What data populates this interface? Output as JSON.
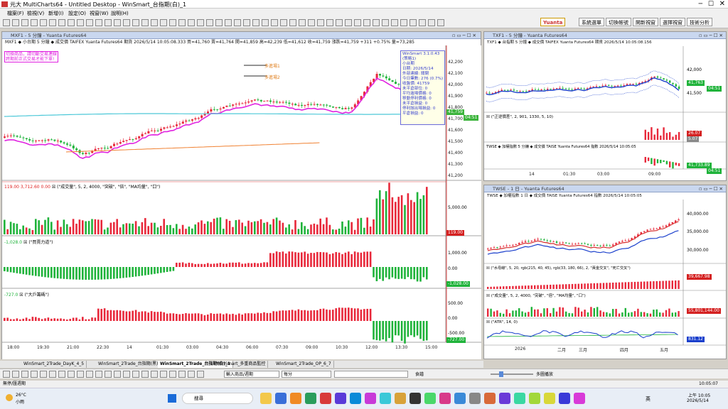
{
  "app": {
    "title": "元大 MultiCharts64 - Untitled Desktop - WinSmart_台指期(白)_1"
  },
  "menu": [
    "檔案(F)",
    "檢視(V)",
    "新增(I)",
    "設定(O)",
    "視窗(W)",
    "說明(H)"
  ],
  "toolbar_brand": {
    "logo": "Yuanta",
    "buttons": [
      "系統選單",
      "切換帳號",
      "開新視窗",
      "選擇視窗",
      "技術分析"
    ]
  },
  "left_window": {
    "title": "MXF1 - 5 分鐘 - Yuanta Futures64",
    "header": "MXF1  ◆ 小台期 5 分鐘 ◆ 成交價  TAIFEX  Yuanta Futures64  期貨  2026/5/14  10:05:08.333  買=41,760  賣=41,764  開=41,859  高=42,239  低=41,612  收=41,759  漲跌=41,759  +311  +0.75%  量=73,285",
    "note_lines": [
      "切換商品，請切斷交易連線",
      "跨期前正式交易才能下單!"
    ],
    "marker1": "多進場1",
    "marker2": "多進場2",
    "price_ticks": [
      "42,200",
      "42,100",
      "42,000",
      "41,900",
      "41,800",
      "41,700",
      "41,600",
      "41,500",
      "41,400",
      "41,300",
      "41,200"
    ],
    "last_price": "41,759",
    "countdown": "04:51",
    "info_box": [
      "WinSmart 3.1.0.43",
      "(策略1)",
      "小台期",
      "日期: 2026/5/14",
      "外部連線: 關閉",
      "今日筆數: 276 (0.7%)",
      "收盤價: 41759",
      "未平倉部位: 0",
      "平均進場價格: 0",
      "移動停利價格: 0",
      "未平倉損益: 0",
      "停利該出場損益: 0",
      "平倉損益: 0"
    ],
    "volume_header": "(\"成交量\", 5, 2, 4000, \"突破\", \"倍\", \"MA均量\", \"口\")",
    "volume_values": "119.00  3,712.60  0.00",
    "volume_tick": "5,000.00",
    "volume_last": "119.00",
    "power_header": "(\"買賣力道\")",
    "power_value": "-1,028.0",
    "power_ticks": [
      "1,000.00",
      "0.00"
    ],
    "power_last": "-1,028.00",
    "big_header": "(\"大戶籌碼\")",
    "big_value": "-727.0",
    "big_ticks": [
      "500.00",
      "0.00",
      "-500.00"
    ],
    "big_last": "-727.00",
    "time_axis": [
      "18:00",
      "19:30",
      "21:00",
      "22:30",
      "14",
      "01:30",
      "03:00",
      "04:30",
      "06:00",
      "07:30",
      "09:00",
      "10:30",
      "12:00",
      "13:30",
      "15:00"
    ]
  },
  "right_top": {
    "title": "TXF1 - 5 分鐘 - Yuanta Futures64",
    "header": "TXF1  ◆ 台指期 5 分鐘 ◆ 成交價  TAIFEX  Yuanta Futures64  期貨  2026/5/14  10:05:08.156",
    "ticks": [
      "42,000",
      "41,500"
    ],
    "last": "41,763",
    "last2": "04:51",
    "sub_header": "(\"正逆價差\", 2, 901, 1330, 5, 10)",
    "sub_last": "26.07",
    "sub_last2": "5.07",
    "twse_header": "TWSE  ◆ 加權指數 5 分鐘 ◆ 成交價  TAISE  Yuanta Futures64  指數  2026/5/14  10:05:05",
    "twse_last": "41,733.89",
    "twse_last2": "04:51",
    "time_axis": [
      "14",
      "01:30",
      "03:00",
      "09:00"
    ]
  },
  "right_bottom": {
    "title": "TWSE - 1 日 - Yuanta Futures64",
    "header": "TWSE  ◆ 加權指數 1 日 ◆ 成交價  TAISE  Yuanta Futures64  指數  2026/5/14  10:05:05",
    "ticks": [
      "40,000.00",
      "35,000.00",
      "30,000.00"
    ],
    "last": "41,733.89",
    "ind1_header": "(\"水母線\", 5, 20, rgb(215, 40, 45), rgb(33, 180, 66), 2, \"黃金交叉\", \"死亡交叉\")",
    "ind1_last": "39,667.98",
    "ind2_header": "(\"成交量\", 5, 2, 4000, \"突破\", \"倍\", \"MA均量\", \"口\")",
    "ind2_last": "55,801,144.00",
    "ind3_header": "(\"ATR\", 14, 0)",
    "ind3_last": "831.12",
    "time_axis": [
      "2026",
      "二月",
      "三月",
      "四月",
      "五月"
    ]
  },
  "tabs": [
    "WinSmart_2Trade_DayK_4_5",
    "WinSmart_2Trade_台指期(黑)_2_3",
    "WinSmart_2Trade_台指期(白)_1",
    "WinSmart_多重商品監控",
    "WinSmart_2Trade_OP_6_7"
  ],
  "drawbar": {
    "symbol_placeholder": "輸入商品/週期",
    "period": "每分",
    "recipe": "食譜",
    "multi": "多圖播放"
  },
  "status": {
    "left": "無停/匯週期",
    "time": "10:05:07"
  },
  "taskbar": {
    "weather_temp": "26°C",
    "weather_text": "小雨",
    "search": "搜尋",
    "time": "上午 10:05",
    "date": "2026/5/14",
    "lang": "英"
  },
  "colors": {
    "bull": "#e8293b",
    "bear": "#1fb33a",
    "magenta": "#e022e0",
    "cyan": "#4cc8d8",
    "orange": "#f08030",
    "blue": "#1a3fcc"
  }
}
